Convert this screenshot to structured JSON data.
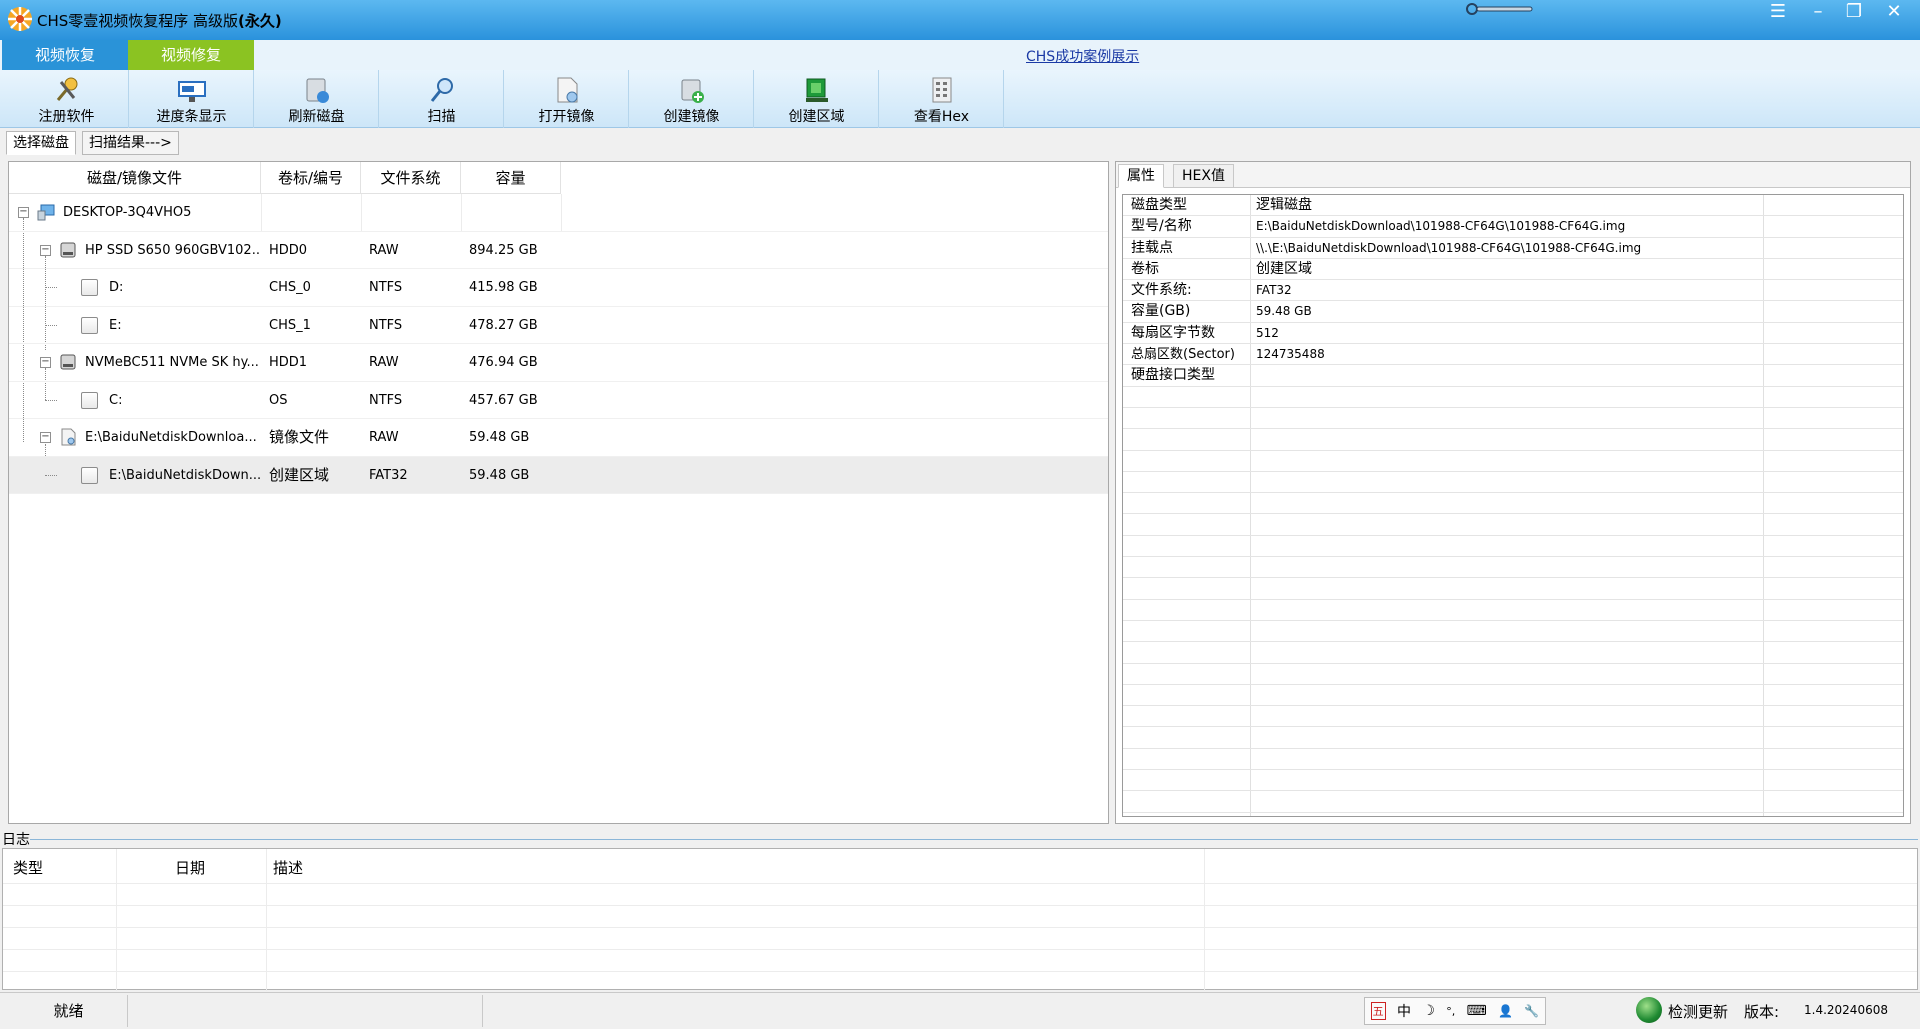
{
  "window": {
    "title": "CHS零壹视频恢复程序 高级版",
    "title_suffix": "(永久)"
  },
  "top_tabs": [
    {
      "label": "视频恢复",
      "active": true
    },
    {
      "label": "视频修复",
      "active": false
    }
  ],
  "case_link": "CHS成功案例展示",
  "toolbar": [
    {
      "label": "注册软件",
      "icon": "key-tools-icon"
    },
    {
      "label": "进度条显示",
      "icon": "progress-monitor-icon"
    },
    {
      "label": "刷新磁盘",
      "icon": "refresh-disk-icon"
    },
    {
      "label": "扫描",
      "icon": "magnifier-icon"
    },
    {
      "label": "打开镜像",
      "icon": "open-image-icon"
    },
    {
      "label": "创建镜像",
      "icon": "create-image-icon"
    },
    {
      "label": "创建区域",
      "icon": "create-region-icon"
    },
    {
      "label": "查看Hex",
      "icon": "hex-view-icon"
    }
  ],
  "sub_tabs": [
    {
      "label": "选择磁盘",
      "active": true
    },
    {
      "label": "扫描结果--->",
      "active": false
    }
  ],
  "disk_table": {
    "columns": [
      "磁盘/镜像文件",
      "卷标/编号",
      "文件系统",
      "容量"
    ],
    "rows": [
      {
        "name": "DESKTOP-3Q4VHO5",
        "label": "",
        "fs": "",
        "size": "",
        "level": 0,
        "type": "computer"
      },
      {
        "name": "HP SSD S650 960GBV102...",
        "label": "HDD0",
        "fs": "RAW",
        "size": "894.25 GB",
        "level": 1,
        "type": "disk"
      },
      {
        "name": "D:",
        "label": "CHS_0",
        "fs": "NTFS",
        "size": "415.98 GB",
        "level": 2,
        "type": "partition"
      },
      {
        "name": "E:",
        "label": "CHS_1",
        "fs": "NTFS",
        "size": "478.27 GB",
        "level": 2,
        "type": "partition"
      },
      {
        "name": "NVMeBC511 NVMe SK hy...",
        "label": "HDD1",
        "fs": "RAW",
        "size": "476.94 GB",
        "level": 1,
        "type": "disk"
      },
      {
        "name": "C:",
        "label": "OS",
        "fs": "NTFS",
        "size": "457.67 GB",
        "level": 2,
        "type": "partition"
      },
      {
        "name": "E:\\BaiduNetdiskDownloa...",
        "label": "镜像文件",
        "fs": "RAW",
        "size": "59.48 GB",
        "level": 1,
        "type": "image"
      },
      {
        "name": "E:\\BaiduNetdiskDown...",
        "label": "创建区域",
        "fs": "FAT32",
        "size": "59.48 GB",
        "level": 2,
        "type": "partition",
        "selected": true
      }
    ]
  },
  "prop_tabs": [
    {
      "label": "属性",
      "active": true
    },
    {
      "label": "HEX值",
      "active": false
    }
  ],
  "properties": [
    {
      "key": "磁盘类型",
      "value": "逻辑磁盘"
    },
    {
      "key": "型号/名称",
      "value": "E:\\BaiduNetdiskDownload\\101988-CF64G\\101988-CF64G.img"
    },
    {
      "key": "挂载点",
      "value": "\\\\.\\E:\\BaiduNetdiskDownload\\101988-CF64G\\101988-CF64G.img"
    },
    {
      "key": "卷标",
      "value": "创建区域"
    },
    {
      "key": "文件系统:",
      "value": "FAT32"
    },
    {
      "key": "容量(GB)",
      "value": "59.48 GB"
    },
    {
      "key": "每扇区字节数",
      "value": "512"
    },
    {
      "key": "总扇区数(Sector)",
      "value": "124735488"
    },
    {
      "key": "硬盘接口类型",
      "value": ""
    }
  ],
  "log": {
    "title": "日志",
    "columns": [
      "类型",
      "日期",
      "描述"
    ]
  },
  "status": {
    "state": "就绪",
    "ime_items": [
      "五",
      "中",
      "☽",
      "°,",
      "⌨",
      "👤",
      "🔧"
    ],
    "update_label": "检测更新",
    "version_label": "版本:",
    "version_value": "1.4.20240608"
  },
  "colors": {
    "titlebar": "#2a92dc",
    "tab_active": "#2a93d8",
    "tab_repair": "#8bc322",
    "toolbar": "#cde6f8"
  }
}
